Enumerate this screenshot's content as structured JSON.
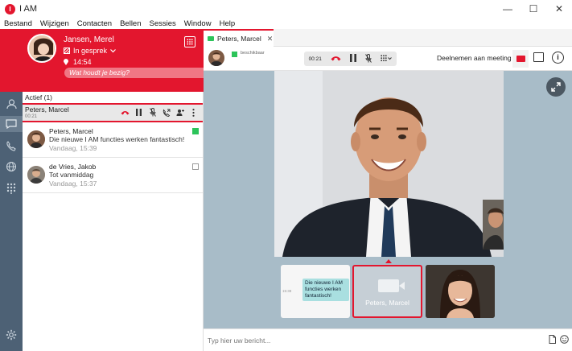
{
  "window": {
    "title": "I AM",
    "logo_text": "I",
    "controls": [
      "—",
      "☐",
      "✕"
    ]
  },
  "menu": [
    "Bestand",
    "Wijzigen",
    "Contacten",
    "Bellen",
    "Sessies",
    "Window",
    "Help"
  ],
  "profile": {
    "name": "Jansen, Merel",
    "status": "In gesprek",
    "time": "14:54",
    "mood_placeholder": "Wat houdt je bezig?"
  },
  "left": {
    "active_header": "Actief (1)",
    "active_call": {
      "name": "Peters, Marcel",
      "time": "00:21"
    },
    "conversations": [
      {
        "name": "Peters, Marcel",
        "message": "Die nieuwe I AM functies werken fantastisch!",
        "date": "Vandaag, 15:39",
        "unread": true
      },
      {
        "name": "de Vries, Jakob",
        "message": "Tot vanmiddag",
        "date": "Vandaag, 15:37",
        "unread": false
      }
    ]
  },
  "tab": {
    "label": "Peters, Marcel"
  },
  "callbar": {
    "status": "beschikbaar",
    "timer": "00:21",
    "join_label": "Deelnemen aan meeting"
  },
  "thumbs": {
    "chat_time": "15:38",
    "chat_text": "Die nieuwe I AM functies werken fantastisch!",
    "self_name": "Peters, Marcel"
  },
  "composer": {
    "placeholder": "Typ hier uw bericht..."
  },
  "colors": {
    "accent": "#e3162e",
    "online": "#2cc45a",
    "rail": "#4d6175"
  }
}
